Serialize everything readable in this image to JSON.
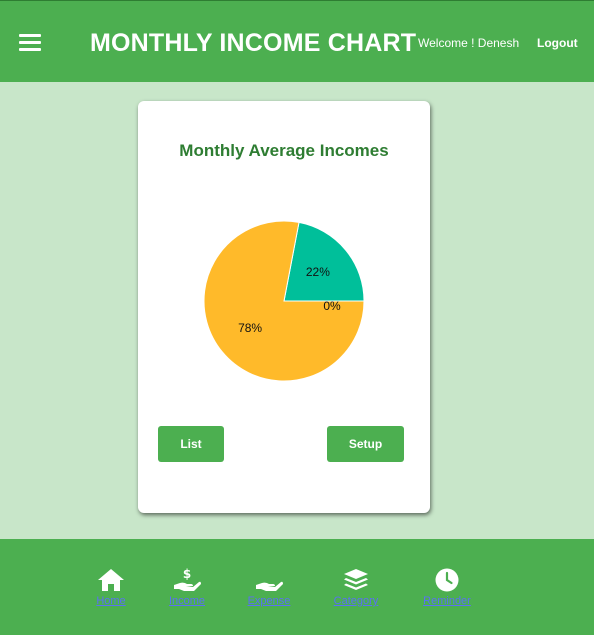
{
  "header": {
    "title": "MONTHLY INCOME CHART",
    "welcome": "Welcome ! Denesh",
    "logout": "Logout"
  },
  "card": {
    "title": "Monthly Average Incomes",
    "list_label": "List",
    "setup_label": "Setup"
  },
  "chart_data": {
    "type": "pie",
    "title": "Monthly Average Incomes",
    "slices": [
      {
        "label": "22%",
        "value": 22,
        "color": "#00bf9a"
      },
      {
        "label": "0%",
        "value": 0,
        "color": "#4caf50"
      },
      {
        "label": "78%",
        "value": 78,
        "color": "#ffba2a"
      }
    ]
  },
  "footer": {
    "items": [
      {
        "label": "Home",
        "icon": "home-icon"
      },
      {
        "label": "Income",
        "icon": "income-icon"
      },
      {
        "label": "Expense",
        "icon": "expense-icon"
      },
      {
        "label": "Category",
        "icon": "category-icon"
      },
      {
        "label": "Reminder",
        "icon": "clock-icon"
      }
    ]
  },
  "colors": {
    "primary": "#4caf50",
    "background": "#c8e6c9",
    "title_green": "#2e7d32",
    "nav_label": "#5b6ff5"
  }
}
